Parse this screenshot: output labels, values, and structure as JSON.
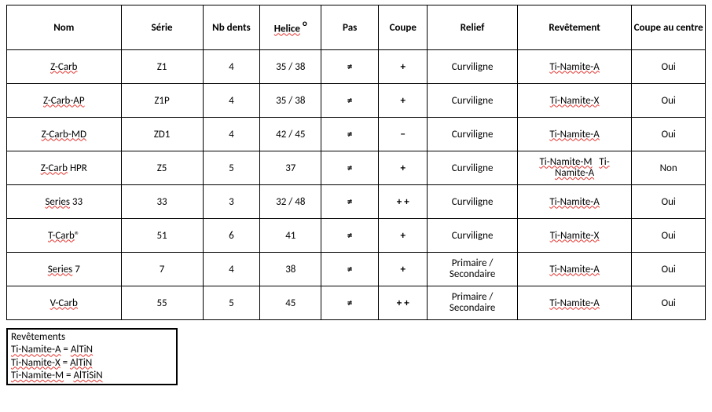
{
  "headers": {
    "nom": "Nom",
    "serie": "Série",
    "nb": "Nb dents",
    "helice": "Helice",
    "helice_deg": "o",
    "pas": "Pas",
    "coupe": "Coupe",
    "relief": "Relief",
    "revetement": "Revêtement",
    "coupe_centre": "Coupe au centre"
  },
  "rows": [
    {
      "nom_wavy": "Z-Carb",
      "nom_plain": "",
      "serie": "Z1",
      "nb": "4",
      "helice": "35 / 38",
      "pas": "≠",
      "coupe": "+",
      "relief_type": "single",
      "relief": "Curviligne",
      "rev_type": "single",
      "rev1": "Ti-Namite-A",
      "rev2": "",
      "cac": "Oui"
    },
    {
      "nom_wavy": "Z-Carb-AP",
      "nom_plain": "",
      "serie": "Z1P",
      "nb": "4",
      "helice": "35 / 38",
      "pas": "≠",
      "coupe": "+",
      "relief_type": "single",
      "relief": "Curviligne",
      "rev_type": "single",
      "rev1": "Ti-Namite-X",
      "rev2": "",
      "cac": "Oui"
    },
    {
      "nom_wavy": "Z-Carb-MD",
      "nom_plain": "",
      "serie": "ZD1",
      "nb": "4",
      "helice": "42 / 45",
      "pas": "≠",
      "coupe": "−",
      "relief_type": "single",
      "relief": "Curviligne",
      "rev_type": "single",
      "rev1": "Ti-Namite-A",
      "rev2": "",
      "cac": "Oui"
    },
    {
      "nom_wavy": "Z-Carb",
      "nom_plain": " HPR",
      "serie": "Z5",
      "nb": "5",
      "helice": "37",
      "pas": "≠",
      "coupe": "+",
      "relief_type": "single",
      "relief": "Curviligne",
      "rev_type": "double",
      "rev1": "Ti-Namite-M",
      "rev2": "Ti-Namite-A",
      "cac": "Non"
    },
    {
      "nom_wavy": "Series",
      "nom_plain": " 33",
      "serie": "33",
      "nb": "3",
      "helice": "32 / 48",
      "pas": "≠",
      "coupe": "+ +",
      "relief_type": "single",
      "relief": "Curviligne",
      "rev_type": "single",
      "rev1": "Ti-Namite-A",
      "rev2": "",
      "cac": "Oui"
    },
    {
      "nom_wavy": "T-Carb",
      "nom_plain": "®",
      "serie": "51",
      "nb": "6",
      "helice": "41",
      "pas": "≠",
      "coupe": "+",
      "relief_type": "single",
      "relief": "Curviligne",
      "rev_type": "single",
      "rev1": "Ti-Namite-X",
      "rev2": "",
      "cac": "Oui"
    },
    {
      "nom_wavy": "Series",
      "nom_plain": " 7",
      "serie": "7",
      "nb": "4",
      "helice": "38",
      "pas": "≠",
      "coupe": "+",
      "relief_type": "double",
      "relief_l1": "Primaire /",
      "relief_l2": "Secondaire",
      "rev_type": "single",
      "rev1": "Ti-Namite-A",
      "rev2": "",
      "cac": "Oui"
    },
    {
      "nom_wavy": "V-Carb",
      "nom_plain": "",
      "serie": "55",
      "nb": "5",
      "helice": "45",
      "pas": "≠",
      "coupe": "+ +",
      "relief_type": "double",
      "relief_l1": "Primaire /",
      "relief_l2": "Secondaire",
      "rev_type": "single",
      "rev1": "Ti-Namite-A",
      "rev2": "",
      "cac": "Oui"
    }
  ],
  "legend": {
    "title": "Revêtements",
    "l1a": "Ti-Namite-A",
    "l1b": " = ",
    "l1c": "AlTiN",
    "l2a": "Ti-Namite-X",
    "l2b": " = ",
    "l2c": "AlTiN",
    "l3a": "Ti-Namite-M",
    "l3b": " = ",
    "l3c": "AlTiSiN"
  }
}
